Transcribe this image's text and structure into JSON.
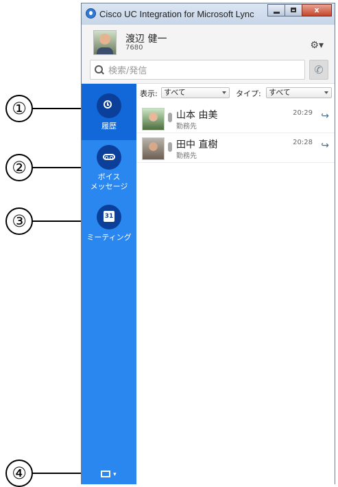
{
  "window": {
    "title": "Cisco UC Integration for Microsoft Lync",
    "close_label": "x"
  },
  "user": {
    "name": "渡辺 健一",
    "extension": "7680"
  },
  "search": {
    "placeholder": "検索/発信"
  },
  "settings_icon": "gear-icon",
  "sidebar": {
    "items": [
      {
        "label": "履歴",
        "icon": "clock-icon",
        "active": true
      },
      {
        "label": "ボイス\nメッセージ",
        "icon": "voicemail-icon"
      },
      {
        "label": "ミーティング",
        "icon": "calendar-icon",
        "icon_text": "31"
      }
    ],
    "device_icon": "screen-icon"
  },
  "filters": {
    "display_label": "表示:",
    "display_value": "すべて",
    "type_label": "タイプ:",
    "type_value": "すべて"
  },
  "history": [
    {
      "name": "山本 由美",
      "type": "勤務先",
      "time": "20:29"
    },
    {
      "name": "田中 直樹",
      "type": "勤務先",
      "time": "20:28"
    }
  ],
  "callouts": [
    "①",
    "②",
    "③",
    "④"
  ],
  "colors": {
    "sidebar": "#2a87f0",
    "sidebar_active": "#1268d8",
    "icon_circle": "#0b3f99"
  }
}
